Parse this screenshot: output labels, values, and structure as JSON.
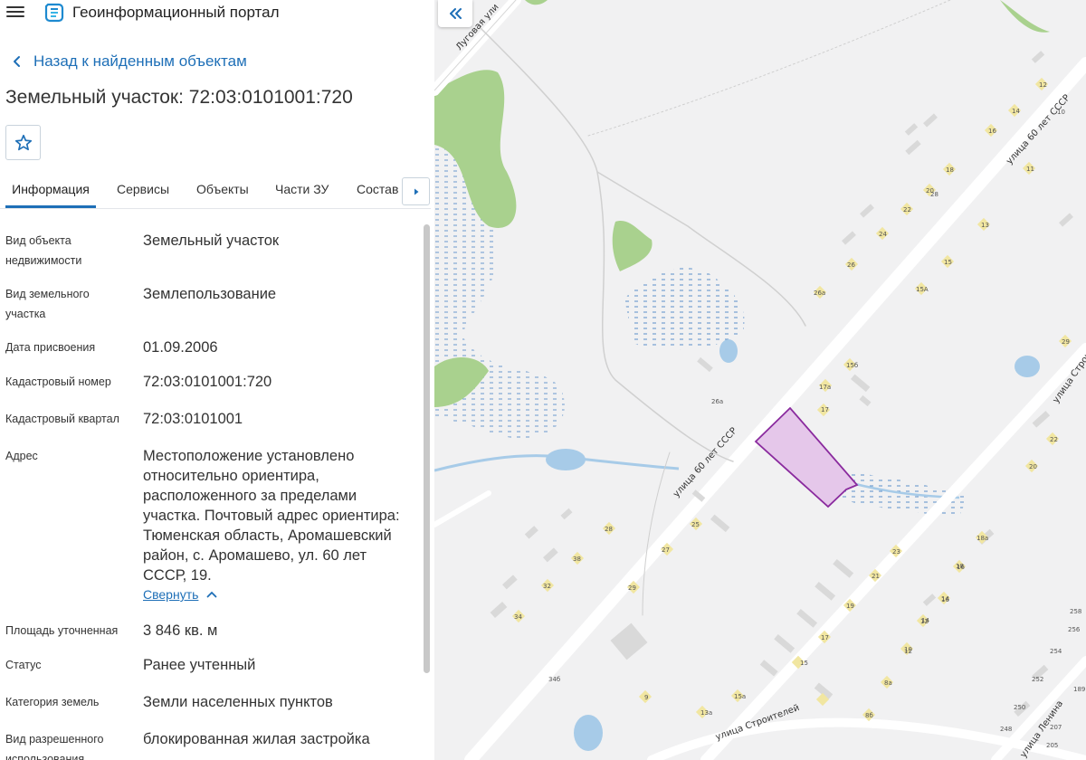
{
  "app": {
    "title": "Геоинформационный портал",
    "menu_icon": "hamburger-menu-icon",
    "logo_icon": "portal-logo-icon"
  },
  "nav": {
    "back_label": "Назад к найденным объектам"
  },
  "object": {
    "title": "Земельный участок: 72:03:0101001:720"
  },
  "tabs": [
    {
      "label": "Информация",
      "active": true
    },
    {
      "label": "Сервисы",
      "active": false
    },
    {
      "label": "Объекты",
      "active": false
    },
    {
      "label": "Части ЗУ",
      "active": false
    },
    {
      "label": "Состав",
      "active": false
    }
  ],
  "details": [
    {
      "label": "Вид объекта недвижимости",
      "value": "Земельный участок"
    },
    {
      "label": "Вид земельного участка",
      "value": "Землепользование"
    },
    {
      "label": "Дата присвоения",
      "value": "01.09.2006"
    },
    {
      "label": "Кадастровый номер",
      "value": "72:03:0101001:720"
    },
    {
      "label": "Кадастровый квартал",
      "value": "72:03:0101001"
    },
    {
      "label": "Адрес",
      "value": "Местоположение установлено относительно ориентира, расположенного за пределами участка. Почтовый адрес ориентира: Тюменская область, Аромашевский район, с. Аромашево, ул. 60 лет СССР, 19."
    },
    {
      "label": "Площадь уточненная",
      "value": "3 846 кв. м"
    },
    {
      "label": "Статус",
      "value": "Ранее учтенный"
    },
    {
      "label": "Категория земель",
      "value": "Земли населенных пунктов"
    },
    {
      "label": "Вид разрешенного использования",
      "value": "блокированная жилая застройка"
    }
  ],
  "collapse_label": "Свернуть",
  "map": {
    "streets": {
      "main": "улица 60 лет СССР",
      "lugovaya": "Луговая ули",
      "stroiteley": "улица Строителей",
      "stroiteley_right": "улица Строите",
      "lenina": "улица Ленина"
    },
    "parcel_color": "#e5c7ea",
    "parcel_border": "#8a2a9e",
    "house_numbers": [
      "12",
      "14",
      "16",
      "18",
      "20",
      "22",
      "24",
      "26",
      "26а",
      "28",
      "13",
      "15",
      "15А",
      "17",
      "17а",
      "15б",
      "26а",
      "11",
      "10",
      "29",
      "22",
      "20",
      "18а",
      "16",
      "14",
      "12",
      "10",
      "8а",
      "9",
      "15а",
      "13а",
      "8б",
      "25",
      "27",
      "28",
      "29",
      "32",
      "34",
      "34б",
      "38",
      "23",
      "21",
      "19",
      "17",
      "15",
      "18",
      "16",
      "14",
      "12",
      "258",
      "256",
      "254",
      "252",
      "250",
      "248",
      "207",
      "205",
      "189"
    ]
  },
  "colors": {
    "accent": "#1e6fb7",
    "map_background": "#f1f1f2",
    "vegetation": "#a9d18e",
    "water": "#a7cbe8",
    "building": "#d9d9d9",
    "building_residential": "#f1e6a1"
  }
}
